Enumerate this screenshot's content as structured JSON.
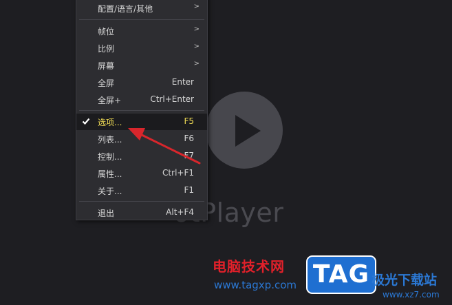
{
  "app": {
    "brand_text": "otPlayer"
  },
  "menu": {
    "items": [
      {
        "label": "配置/语言/其他",
        "accel": "",
        "submenu": true
      },
      {
        "label": "帧位",
        "accel": "",
        "submenu": true
      },
      {
        "label": "比例",
        "accel": "",
        "submenu": true
      },
      {
        "label": "屏幕",
        "accel": "",
        "submenu": true
      },
      {
        "label": "全屏",
        "accel": "Enter",
        "submenu": false
      },
      {
        "label": "全屏+",
        "accel": "Ctrl+Enter",
        "submenu": false
      },
      {
        "label": "选项...",
        "accel": "F5",
        "submenu": false,
        "checked": true,
        "highlighted": true
      },
      {
        "label": "列表...",
        "accel": "F6",
        "submenu": false
      },
      {
        "label": "控制...",
        "accel": "F7",
        "submenu": false
      },
      {
        "label": "属性...",
        "accel": "Ctrl+F1",
        "submenu": false
      },
      {
        "label": "关于...",
        "accel": "F1",
        "submenu": false
      },
      {
        "label": "退出",
        "accel": "Alt+F4",
        "submenu": false
      }
    ],
    "submenu_arrow": ">"
  },
  "watermark": {
    "site_name": "电脑技术网",
    "site_url": "www.tagxp.com",
    "badge": "TAG",
    "site2_name": "极光下载站",
    "site2_url": "www.xz7.com"
  },
  "colors": {
    "background": "#1e1e22",
    "menu_bg": "#2d2d31",
    "highlight_text": "#f1dc55",
    "annotation_arrow": "#d8262c",
    "watermark_red": "#e3202a",
    "watermark_blue": "#2b78d4"
  }
}
